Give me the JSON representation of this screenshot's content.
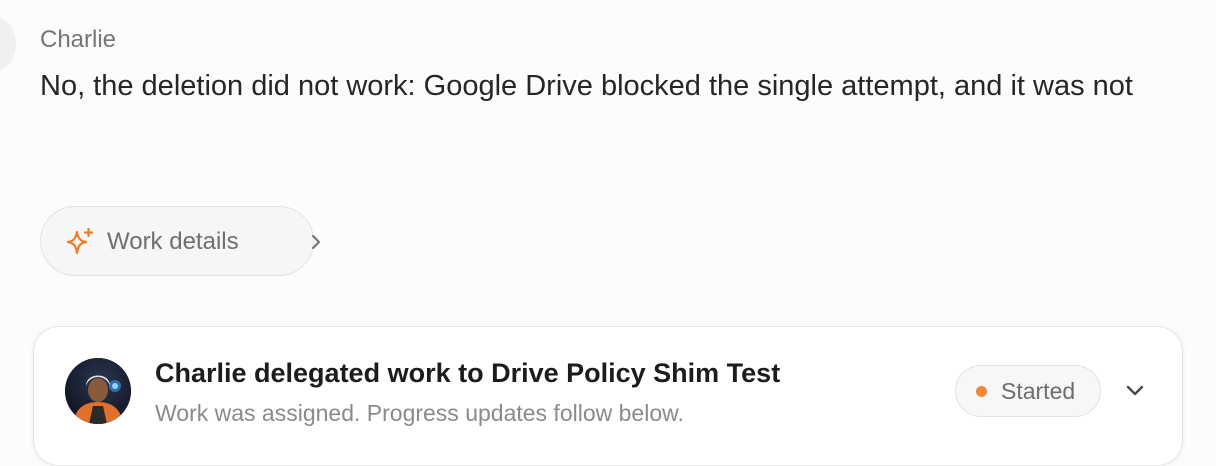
{
  "message": {
    "sender": "Charlie",
    "text": "No, the deletion did not work: Google Drive blocked the single attempt, and it was not"
  },
  "work_details": {
    "label": "Work details",
    "icon": "sparkle-icon",
    "chevron_icon": "chevron-right-icon",
    "accent_color": "#f07a2b"
  },
  "delegation_card": {
    "title": "Charlie delegated work to Drive Policy Shim Test",
    "subtitle": "Work was assigned. Progress updates follow below.",
    "avatar_icon": "agent-avatar",
    "status": {
      "label": "Started",
      "dot_color": "#f2863a"
    },
    "expand_icon": "chevron-down-icon"
  }
}
